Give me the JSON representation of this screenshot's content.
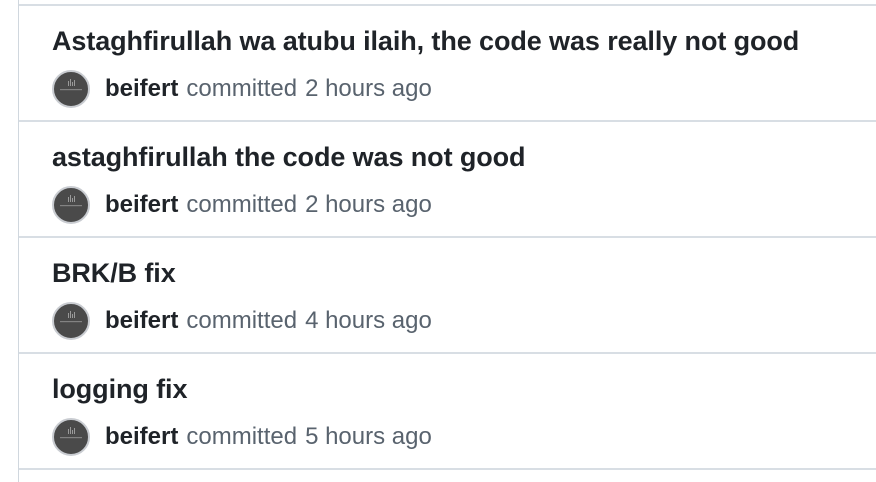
{
  "commits": [
    {
      "title": "Astaghfirullah wa atubu ilaih, the code was really not good",
      "author": "beifert",
      "action": "committed",
      "time": "2 hours ago"
    },
    {
      "title": "astaghfirullah the code was not good",
      "author": "beifert",
      "action": "committed",
      "time": "2 hours ago"
    },
    {
      "title": "BRK/B fix",
      "author": "beifert",
      "action": "committed",
      "time": "4 hours ago"
    },
    {
      "title": "logging fix",
      "author": "beifert",
      "action": "committed",
      "time": "5 hours ago"
    }
  ]
}
